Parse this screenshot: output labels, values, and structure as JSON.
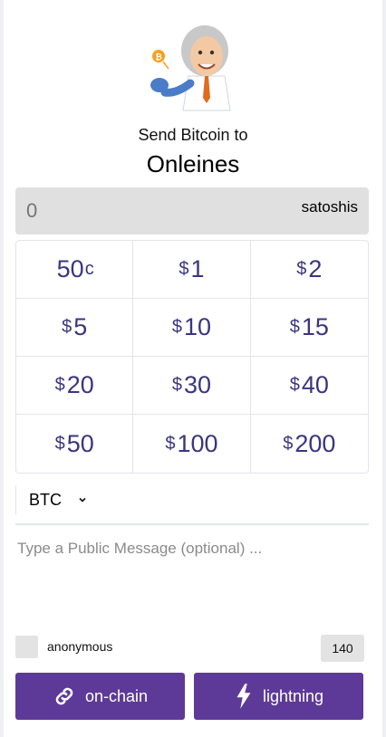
{
  "header": {
    "subtitle": "Send Bitcoin to",
    "recipient": "Onleines"
  },
  "amount": {
    "value": "0",
    "unit": "satoshis"
  },
  "presets": [
    {
      "symbol": "",
      "amount": "50",
      "suffix": "c"
    },
    {
      "symbol": "$",
      "amount": "1",
      "suffix": ""
    },
    {
      "symbol": "$",
      "amount": "2",
      "suffix": ""
    },
    {
      "symbol": "$",
      "amount": "5",
      "suffix": ""
    },
    {
      "symbol": "$",
      "amount": "10",
      "suffix": ""
    },
    {
      "symbol": "$",
      "amount": "15",
      "suffix": ""
    },
    {
      "symbol": "$",
      "amount": "20",
      "suffix": ""
    },
    {
      "symbol": "$",
      "amount": "30",
      "suffix": ""
    },
    {
      "symbol": "$",
      "amount": "40",
      "suffix": ""
    },
    {
      "symbol": "$",
      "amount": "50",
      "suffix": ""
    },
    {
      "symbol": "$",
      "amount": "100",
      "suffix": ""
    },
    {
      "symbol": "$",
      "amount": "200",
      "suffix": ""
    }
  ],
  "currency": {
    "selected": "BTC",
    "icon": "chevron-down-icon"
  },
  "message": {
    "placeholder": "Type a Public Message (optional) ..."
  },
  "anonymous": {
    "label": "anonymous",
    "char_count": "140"
  },
  "buttons": {
    "onchain": {
      "label": "on-chain",
      "icon": "link-icon"
    },
    "lightning": {
      "label": "lightning",
      "icon": "lightning-bolt-icon"
    }
  },
  "colors": {
    "accent": "#5d3a98",
    "preset_text": "#3a3580"
  }
}
